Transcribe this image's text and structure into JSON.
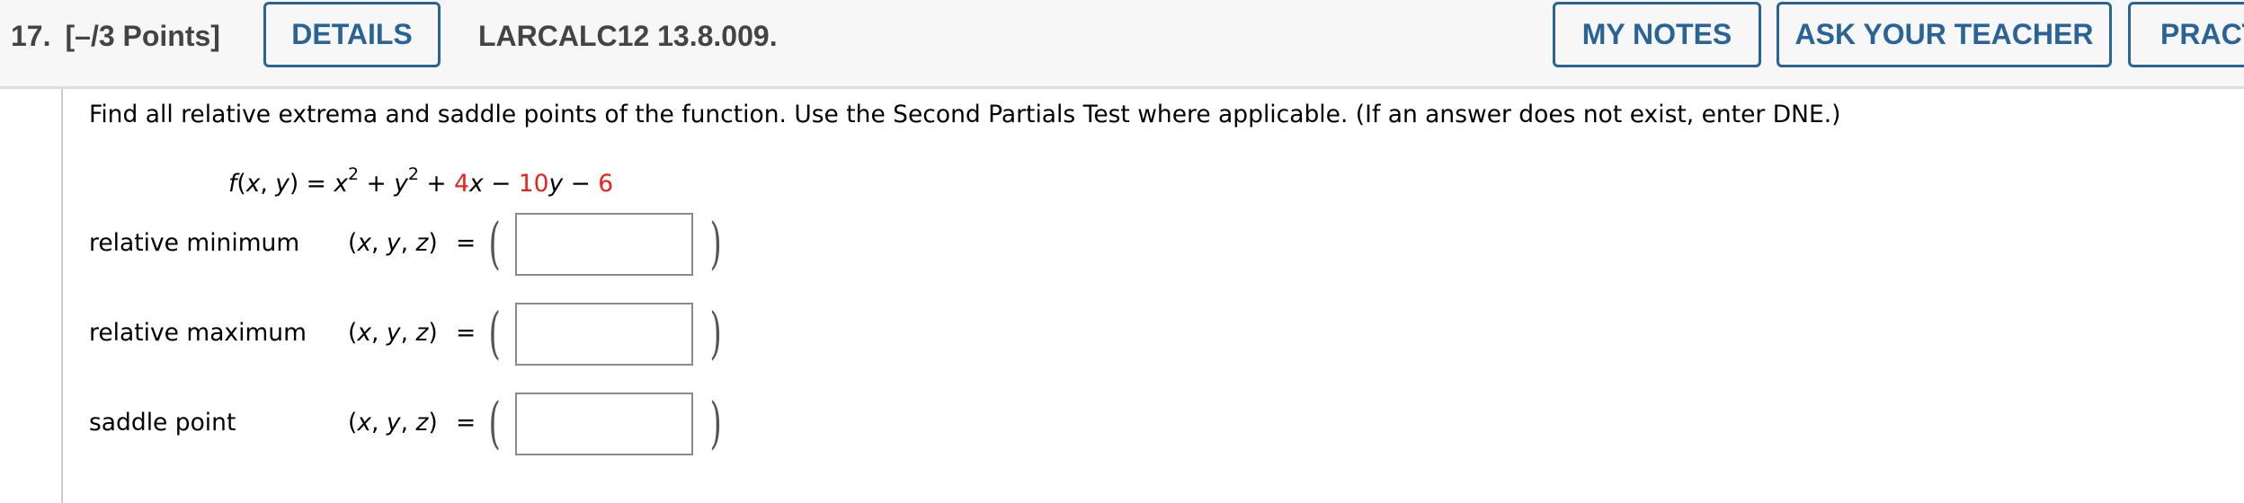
{
  "header": {
    "question_number": "17.",
    "points": "[–/3 Points]",
    "details_label": "DETAILS",
    "question_id": "LARCALC12 13.8.009.",
    "my_notes_label": "MY NOTES",
    "ask_teacher_label": "ASK YOUR TEACHER",
    "practice_label": "PRACTICE ANOTHER"
  },
  "question": {
    "prompt": "Find all relative extrema and saddle points of the function. Use the Second Partials Test where applicable. (If an answer does not exist, enter DNE.)",
    "formula": {
      "lhs": "f(x, y) =",
      "x": "x",
      "y": "y",
      "exp": "2",
      "plus": "+",
      "minus": "−",
      "coef_x": "4",
      "coef_y": "10",
      "constant": "6"
    },
    "answers": [
      {
        "label": "relative minimum",
        "coords": "(x, y, z)",
        "equals": "=",
        "value": ""
      },
      {
        "label": "relative maximum",
        "coords": "(x, y, z)",
        "equals": "=",
        "value": ""
      },
      {
        "label": "saddle point",
        "coords": "(x, y, z)",
        "equals": "=",
        "value": ""
      }
    ]
  },
  "colors": {
    "accent": "#2a6496",
    "highlight": "#e8231c",
    "header_bg": "#f7f7f7"
  }
}
